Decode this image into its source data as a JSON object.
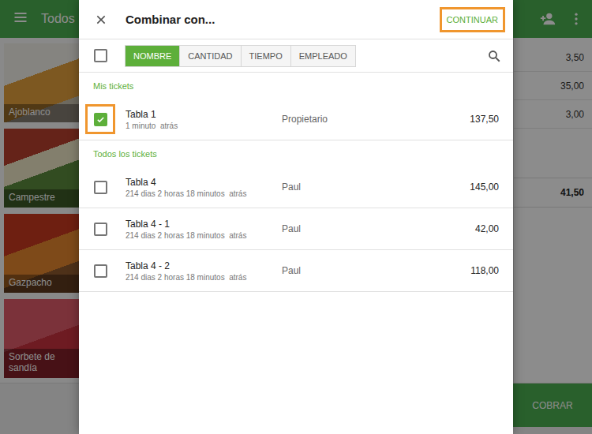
{
  "app": {
    "category": "Todos",
    "items": [
      {
        "name": "Ajoblanco"
      },
      {
        "name": "Campestre"
      },
      {
        "name": "Gazpacho"
      },
      {
        "name": "Sorbete de sandía"
      }
    ],
    "prices": [
      "3,50",
      "35,00",
      "3,00"
    ],
    "total": "41,50",
    "charge_button": "COBRAR"
  },
  "dialog": {
    "title": "Combinar con...",
    "continue_button": {
      "label": "CONTINUAR",
      "highlighted": true
    },
    "select_all": {
      "checked": false
    },
    "sort_tabs": [
      {
        "label": "NOMBRE",
        "selected": true
      },
      {
        "label": "CANTIDAD",
        "selected": false
      },
      {
        "label": "TIEMPO",
        "selected": false
      },
      {
        "label": "EMPLEADO",
        "selected": false
      }
    ],
    "sections": [
      {
        "title": "Mis tickets",
        "tickets": [
          {
            "name": "Tabla 1",
            "time": "1 minuto  atrás",
            "employee": "Propietario",
            "amount": "137,50",
            "checked": true,
            "highlighted": true
          }
        ]
      },
      {
        "title": "Todos los tickets",
        "tickets": [
          {
            "name": "Tabla 4",
            "time": "214 dias 2 horas 18 minutos  atrás",
            "employee": "Paul",
            "amount": "145,00",
            "checked": false,
            "highlighted": false
          },
          {
            "name": "Tabla 4 - 1",
            "time": "214 dias 2 horas 18 minutos  atrás",
            "employee": "Paul",
            "amount": "42,00",
            "checked": false,
            "highlighted": false
          },
          {
            "name": "Tabla 4 - 2",
            "time": "214 dias 2 horas 18 minutos  atrás",
            "employee": "Paul",
            "amount": "118,00",
            "checked": false,
            "highlighted": false
          }
        ]
      }
    ]
  }
}
